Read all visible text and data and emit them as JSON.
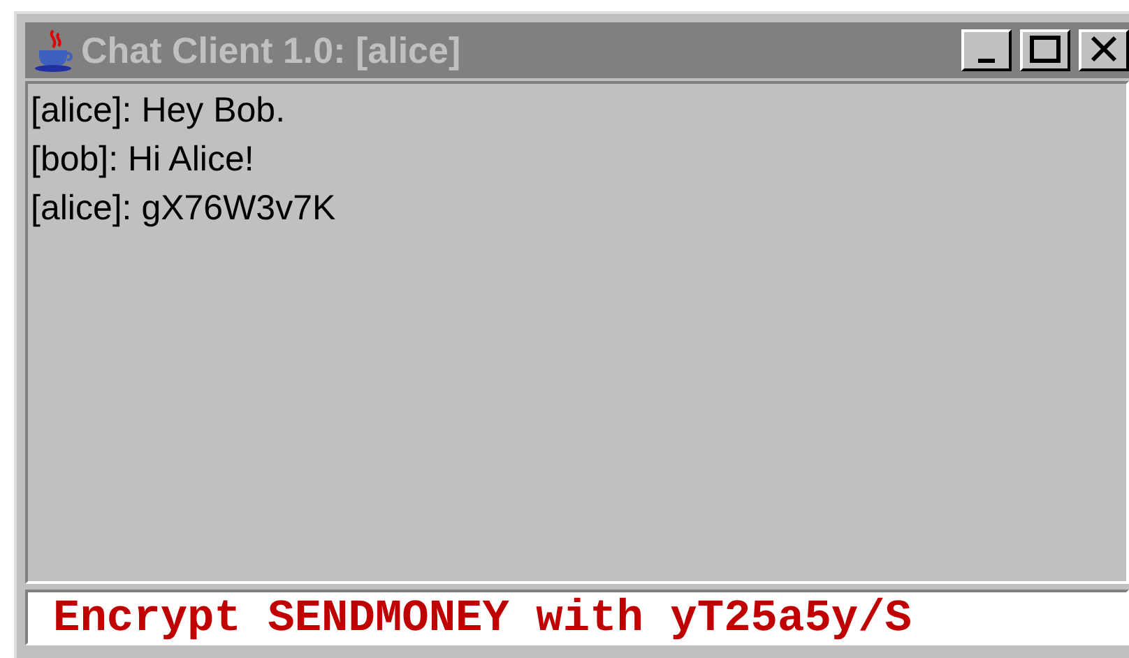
{
  "window": {
    "title": "Chat Client 1.0: [alice]",
    "active": false
  },
  "messages": [
    {
      "text": "[alice]: Hey Bob."
    },
    {
      "text": "[bob]: Hi Alice!"
    },
    {
      "text": "[alice]: gX76W3v7K"
    }
  ],
  "input": {
    "value": "Encrypt SENDMONEY with yT25a5y/S"
  }
}
